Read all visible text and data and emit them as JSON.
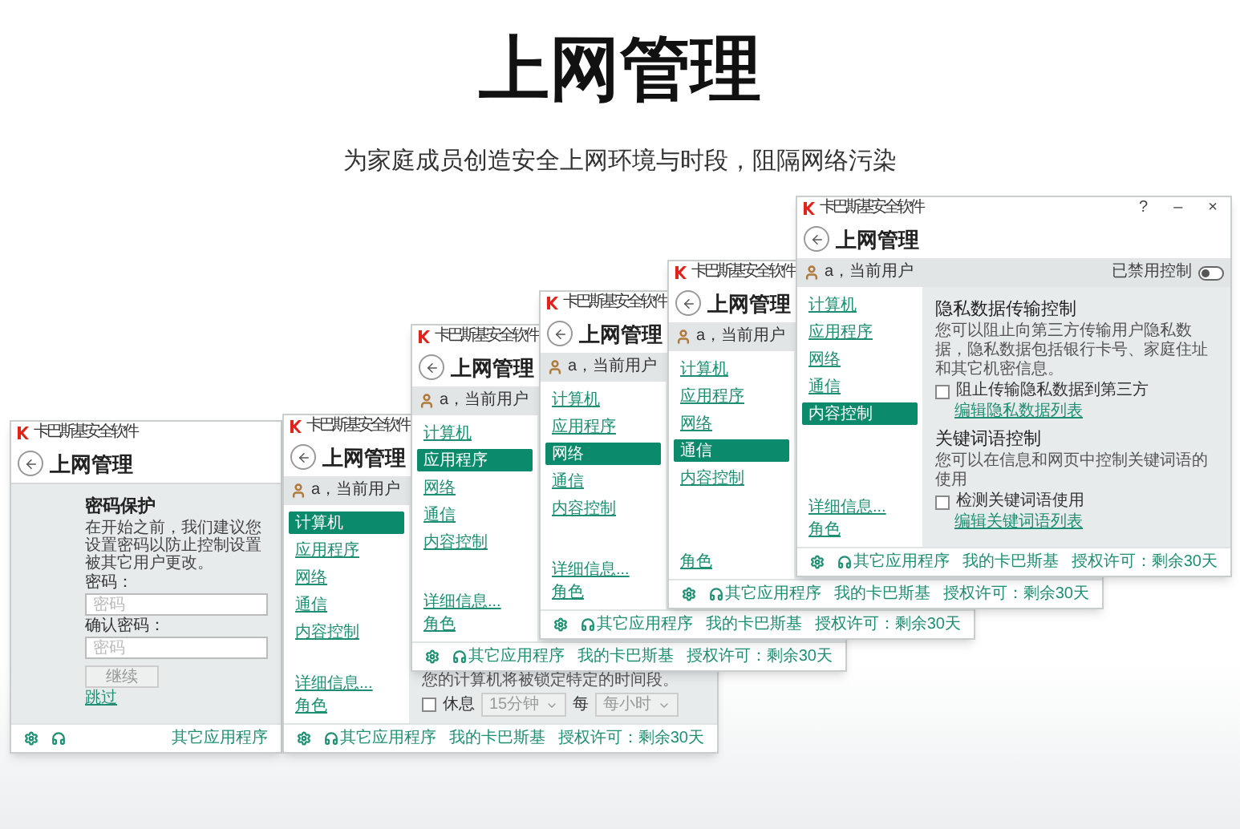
{
  "heading": "上网管理",
  "subheading": "为家庭成员创造安全上网环境与时段，阻隔网络污染",
  "windows": [
    {
      "kind": "password",
      "app_name": "卡巴斯基安全软件",
      "title": "上网管理",
      "password": {
        "title": "密码保护",
        "description": "在开始之前，我们建议您设置密码以防止控制设置被其它用户更改。",
        "fields": [
          {
            "label": "密码：",
            "placeholder": "密码"
          },
          {
            "label": "确认密码：",
            "placeholder": "密码"
          }
        ],
        "button": "继续",
        "skip": "跳过"
      },
      "footer_links": [
        "其它应用程序"
      ]
    },
    {
      "kind": "settings-partial",
      "app_name": "卡巴斯基安全软件",
      "title": "上网管理",
      "user": "a，当前用户",
      "sidebar": {
        "items": [
          {
            "label": "计算机",
            "selected": true
          },
          {
            "label": "应用程序",
            "selected": false
          },
          {
            "label": "网络",
            "selected": false
          },
          {
            "label": "通信",
            "selected": false
          },
          {
            "label": "内容控制",
            "selected": false
          }
        ],
        "bottom_links": [
          "详细信息...",
          "角色"
        ]
      },
      "content": [
        {
          "kind": "text",
          "text": "您的计算机将被锁定特定的时间段。"
        },
        {
          "kind": "schedule",
          "checkbox": {
            "label": "休息",
            "checked": false
          },
          "duration": "15分钟",
          "every": "每",
          "interval": "每小时"
        }
      ],
      "footer_links": [
        "其它应用程序",
        "我的卡巴斯基",
        "授权许可：剩余30天"
      ]
    },
    {
      "kind": "settings",
      "app_name": "卡巴斯基安全软件",
      "title": "上网管理",
      "user": "a，当前用户",
      "sidebar": {
        "items": [
          {
            "label": "计算机",
            "selected": false
          },
          {
            "label": "应用程序",
            "selected": true
          },
          {
            "label": "网络",
            "selected": false
          },
          {
            "label": "通信",
            "selected": false
          },
          {
            "label": "内容控制",
            "selected": false
          }
        ],
        "bottom_links": [
          "详细信息...",
          "角色"
        ]
      },
      "footer_links": [
        "其它应用程序",
        "我的卡巴斯基",
        "授权许可：剩余30天"
      ]
    },
    {
      "kind": "settings",
      "app_name": "卡巴斯基安全软件",
      "title": "上网管理",
      "user": "a，当前用户",
      "sidebar": {
        "items": [
          {
            "label": "计算机",
            "selected": false
          },
          {
            "label": "应用程序",
            "selected": false
          },
          {
            "label": "网络",
            "selected": true
          },
          {
            "label": "通信",
            "selected": false
          },
          {
            "label": "内容控制",
            "selected": false
          }
        ],
        "bottom_links": [
          "详细信息...",
          "角色"
        ]
      },
      "footer_links": [
        "其它应用程序",
        "我的卡巴斯基",
        "授权许可：剩余30天"
      ]
    },
    {
      "kind": "settings",
      "app_name": "卡巴斯基安全软件",
      "title": "上网管理",
      "user": "a，当前用户",
      "sidebar": {
        "items": [
          {
            "label": "计算机",
            "selected": false
          },
          {
            "label": "应用程序",
            "selected": false
          },
          {
            "label": "网络",
            "selected": false
          },
          {
            "label": "通信",
            "selected": true
          },
          {
            "label": "内容控制",
            "selected": false
          }
        ],
        "bottom_links": [
          "角色"
        ]
      },
      "footer_links": [
        "其它应用程序",
        "我的卡巴斯基",
        "授权许可：剩余30天"
      ]
    },
    {
      "kind": "settings",
      "app_name": "卡巴斯基安全软件",
      "title": "上网管理",
      "window_controls": [
        "?",
        "–",
        "×"
      ],
      "user": "a，当前用户",
      "toggle": {
        "label": "已禁用控制",
        "on": false
      },
      "sidebar": {
        "items": [
          {
            "label": "计算机",
            "selected": false
          },
          {
            "label": "应用程序",
            "selected": false
          },
          {
            "label": "网络",
            "selected": false
          },
          {
            "label": "通信",
            "selected": false
          },
          {
            "label": "内容控制",
            "selected": true
          }
        ],
        "bottom_links": [
          "详细信息...",
          "角色"
        ]
      },
      "content": [
        {
          "kind": "heading",
          "text": "隐私数据传输控制"
        },
        {
          "kind": "text",
          "text": "您可以阻止向第三方传输用户隐私数据，隐私数据包括银行卡号、家庭住址和其它机密信息。"
        },
        {
          "kind": "checkbox",
          "label": "阻止传输隐私数据到第三方",
          "checked": false
        },
        {
          "kind": "link",
          "text": "编辑隐私数据列表"
        },
        {
          "kind": "heading",
          "text": "关键词语控制"
        },
        {
          "kind": "text",
          "text": "您可以在信息和网页中控制关键词语的使用"
        },
        {
          "kind": "checkbox",
          "label": "检测关键词语使用",
          "checked": false
        },
        {
          "kind": "link",
          "text": "编辑关键词语列表"
        }
      ],
      "footer_links": [
        "其它应用程序",
        "我的卡巴斯基",
        "授权许可：剩余30天"
      ]
    }
  ]
}
